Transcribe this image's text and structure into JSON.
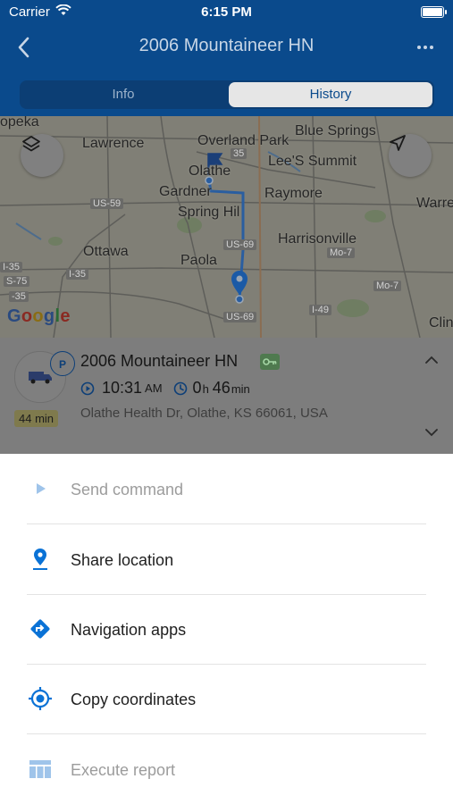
{
  "status_bar": {
    "carrier": "Carrier",
    "time": "6:15 PM"
  },
  "nav": {
    "title": "2006 Mountaineer HN"
  },
  "tabs": [
    {
      "label": "Info"
    },
    {
      "label": "History"
    }
  ],
  "map": {
    "places": {
      "opeka": "opeka",
      "lawrence": "Lawrence",
      "overland_park": "Overland Park",
      "blue_springs": "Blue Springs",
      "olathe": "Olathe",
      "lees_summit": "Lee'S Summit",
      "gardner": "Gardner",
      "raymore": "Raymore",
      "spring_hill": "Spring Hil",
      "warrensburg": "Warre",
      "harrisonville": "Harrisonville",
      "ottawa": "Ottawa",
      "paola": "Paola",
      "clinton": "Clin"
    },
    "highways": {
      "us59": "US-59",
      "i35_a": "I-35",
      "us69_a": "US-69",
      "mo7_a": "Mo-7",
      "us75": "S-75",
      "i35_b": "-35",
      "i35_c": "I-35",
      "us69_b": "US-69",
      "i49": "I-49",
      "mo7_b": "Mo-7",
      "hw35": "35"
    },
    "brand": "Google"
  },
  "vehicle": {
    "name": "2006 Mountaineer HN",
    "status_letter": "P",
    "duration_badge": "44 min",
    "time_value": "10:31",
    "time_suffix": "AM",
    "dur_h": "0",
    "dur_h_unit": "h",
    "dur_m": "46",
    "dur_m_unit": "min",
    "address": "Olathe Health Dr, Olathe, KS 66061, USA"
  },
  "actions": [
    {
      "label": "Send command",
      "icon": "play-icon",
      "enabled": false
    },
    {
      "label": "Share location",
      "icon": "location-pin-icon",
      "enabled": true
    },
    {
      "label": "Navigation apps",
      "icon": "directions-icon",
      "enabled": true
    },
    {
      "label": "Copy coordinates",
      "icon": "target-icon",
      "enabled": true
    },
    {
      "label": "Execute report",
      "icon": "table-icon",
      "enabled": false
    }
  ],
  "colors": {
    "header": "#0a4a8c",
    "accent": "#0a72d6",
    "disabled": "#9fc4ea",
    "overlay_map": "#807f76"
  }
}
